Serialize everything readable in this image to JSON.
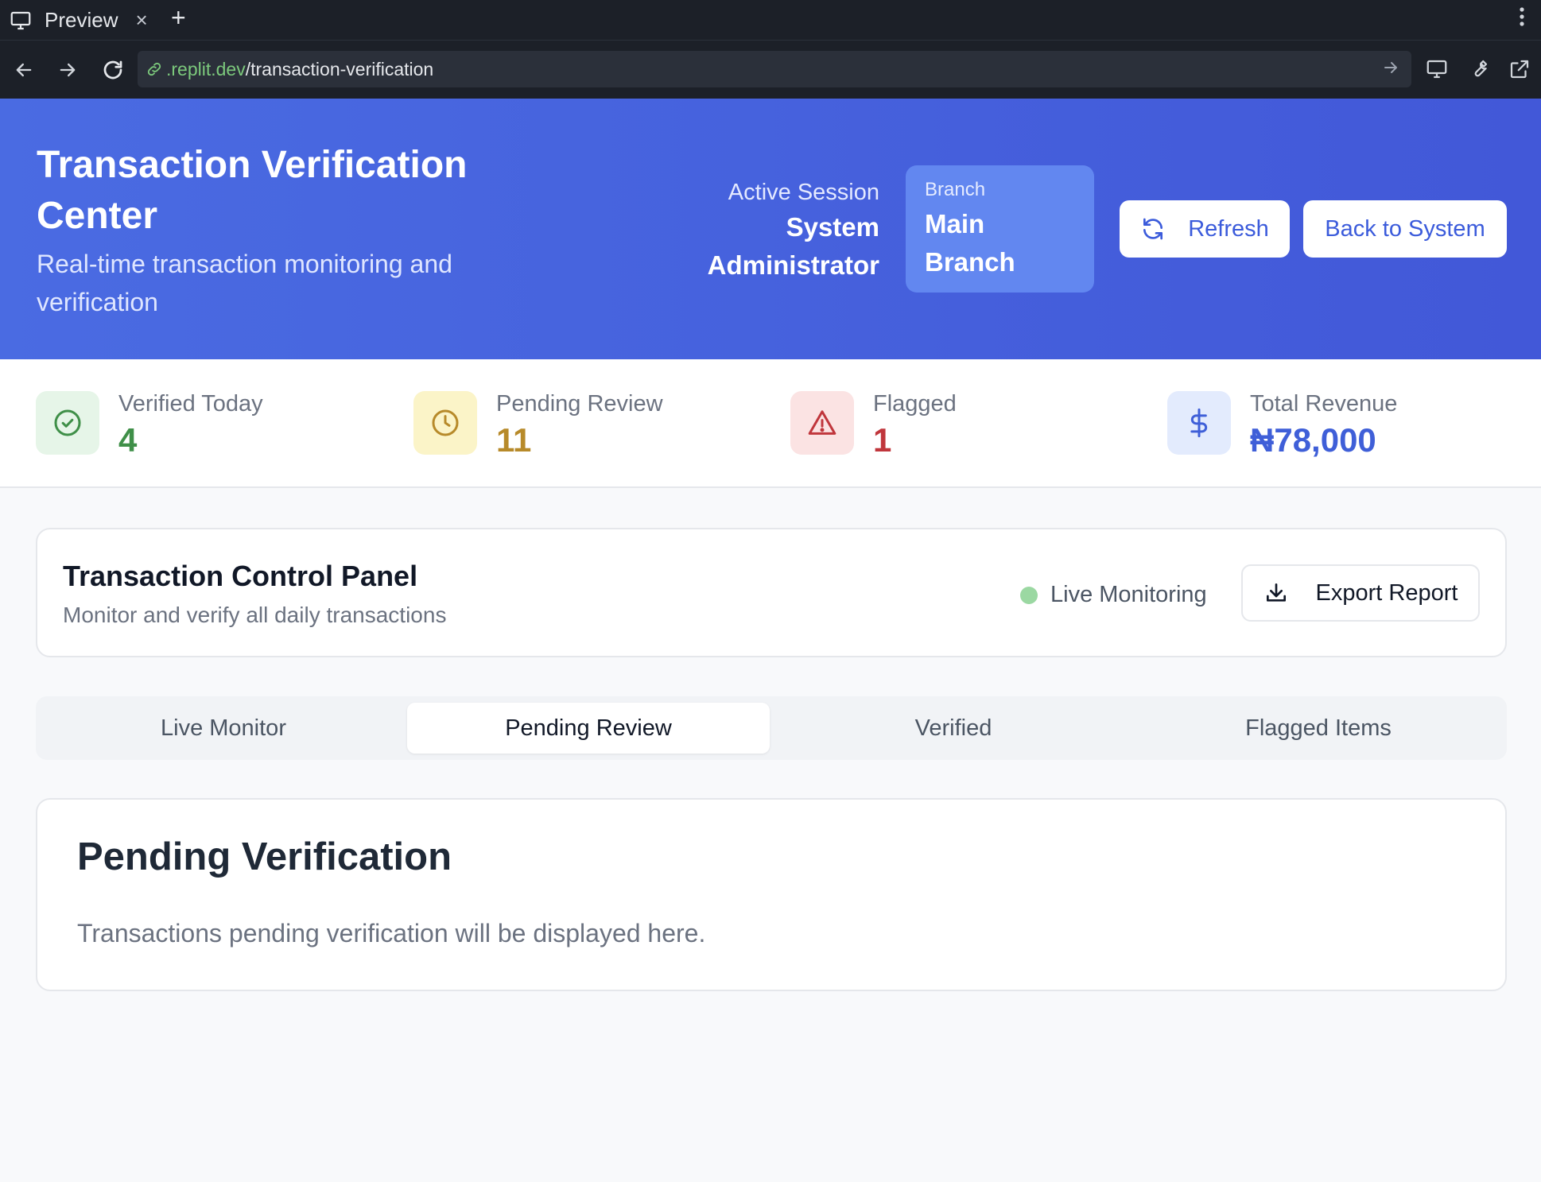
{
  "browser": {
    "tab_title": "Preview",
    "close_glyph": "×",
    "new_tab_glyph": "+",
    "url_host": ".replit.dev",
    "url_path": "/transaction-verification"
  },
  "header": {
    "title": "Transaction Verification Center",
    "subtitle": "Real-time transaction monitoring and verification",
    "session_label": "Active Session",
    "session_value": "System Administrator",
    "branch_label": "Branch",
    "branch_value": "Main Branch",
    "refresh_label": "Refresh",
    "back_label": "Back to System"
  },
  "stats": [
    {
      "label": "Verified Today",
      "value": "4",
      "icon": "check-circle-icon",
      "color": "#3f8f48",
      "bg": "#e6f5e8"
    },
    {
      "label": "Pending Review",
      "value": "11",
      "icon": "clock-icon",
      "color": "#b78a2a",
      "bg": "#fbf4c8"
    },
    {
      "label": "Flagged",
      "value": "1",
      "icon": "alert-triangle-icon",
      "color": "#c0363c",
      "bg": "#fbe3e3"
    },
    {
      "label": "Total Revenue",
      "value": "₦78,000",
      "icon": "dollar-icon",
      "color": "#3f5fd8",
      "bg": "#e3ebfd"
    }
  ],
  "control_panel": {
    "title": "Transaction Control Panel",
    "subtitle": "Monitor and verify all daily transactions",
    "live_label": "Live Monitoring",
    "export_label": "Export Report"
  },
  "tabs": [
    {
      "label": "Live Monitor",
      "active": false
    },
    {
      "label": "Pending Review",
      "active": true
    },
    {
      "label": "Verified",
      "active": false
    },
    {
      "label": "Flagged Items",
      "active": false
    }
  ],
  "pending": {
    "title": "Pending Verification",
    "text": "Transactions pending verification will be displayed here."
  },
  "colors": {
    "header_start": "#4a6be2",
    "header_end": "#4258d8",
    "accent": "#3b5bdb",
    "live_dot": "#9bd8a2"
  }
}
